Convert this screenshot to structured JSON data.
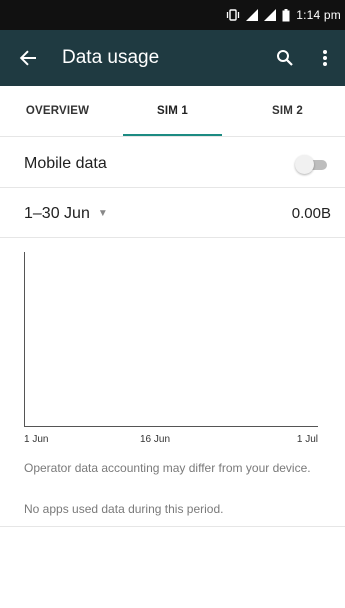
{
  "status_bar": {
    "time": "1:14 pm",
    "icons": [
      "vibrate-icon",
      "signal-icon",
      "signal-icon",
      "battery-icon"
    ]
  },
  "toolbar": {
    "title": "Data usage",
    "back_icon": "arrow-back-icon",
    "search_icon": "search-icon",
    "more_icon": "more-vert-icon",
    "background": "#1f3a41"
  },
  "tabs": [
    {
      "label": "OVERVIEW",
      "active": false
    },
    {
      "label": "SIM 1",
      "active": true
    },
    {
      "label": "SIM 2",
      "active": false
    }
  ],
  "mobile_data": {
    "label": "Mobile data",
    "enabled": false
  },
  "cycle": {
    "period": "1–30 Jun",
    "total": "0.00B"
  },
  "chart": {
    "x_labels": [
      "1 Jun",
      "16 Jun",
      "1 Jul"
    ]
  },
  "notes": {
    "accounting": "Operator data accounting may differ from your device.",
    "no_apps": "No apps used data during this period."
  },
  "colors": {
    "accent": "#1c8b82",
    "status_bar": "#111111"
  }
}
